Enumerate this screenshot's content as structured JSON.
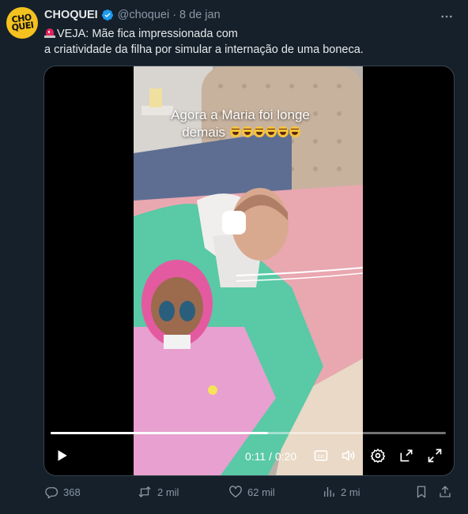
{
  "tweet": {
    "avatar_text_top": "CHO",
    "avatar_text_bottom": "QUEI",
    "display_name": "CHOQUEI",
    "handle": "@choquei",
    "separator": "·",
    "date": "8 de jan",
    "text_line1": "VEJA: Mãe fica impressionada com",
    "text_line2": "a criatividade da filha por simular a internação de uma boneca."
  },
  "video": {
    "caption_line1": "Agora a Maria foi longe",
    "caption_line2": "demais",
    "caption_emoji_count": 6,
    "current_time": "0:11",
    "time_separator": "/",
    "duration": "0:20",
    "progress_fraction": 0.55
  },
  "actions": {
    "replies": "368",
    "reposts": "2 mil",
    "likes": "62 mil",
    "views": "2 mi"
  },
  "colors": {
    "background": "#15202b",
    "verified": "#1d9bf0",
    "muted_text": "#8b98a5",
    "avatar": "#f4c21f"
  }
}
